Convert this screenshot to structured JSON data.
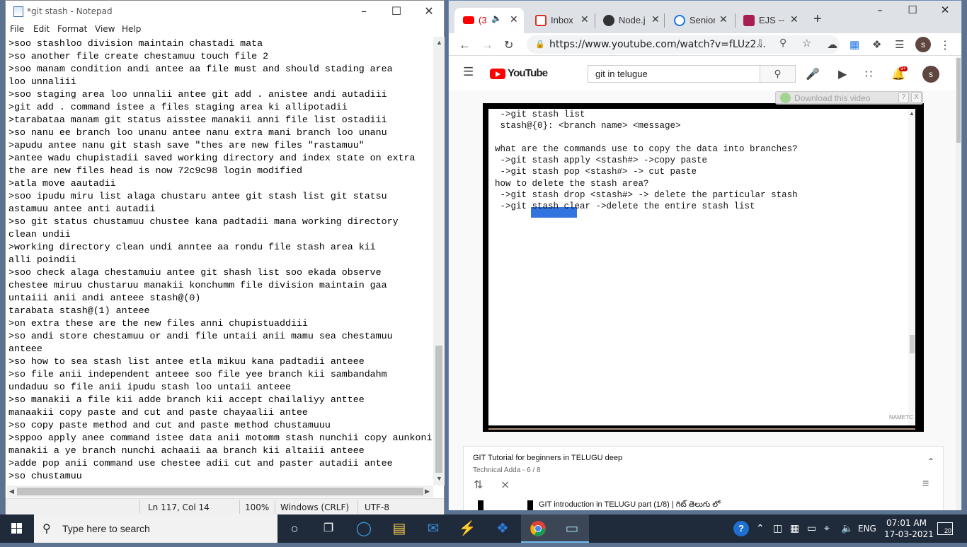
{
  "notepad": {
    "title": "*git stash - Notepad",
    "menu": [
      "File",
      "Edit",
      "Format",
      "View",
      "Help"
    ],
    "lines": [
      ">soo stashloo division maintain chastadi mata",
      ">so another file create chestamuu touch file 2",
      ">soo manam condition andi antee aa file must and should stading area",
      "loo unnaliii",
      ">soo staging area loo unnalii antee git add . anistee andi autadiii",
      ">git add . command istee a files staging area ki allipotadii",
      ">tarabataa manam git status aisstee manakii anni file list ostadiii",
      ">so nanu ee branch loo unanu antee nanu extra mani branch loo unanu",
      ">apudu antee nanu git stash save \"thes are new files \"rastamuu\"",
      ">antee wadu chupistadii saved working directory and index state on extra",
      "the are new files head is now 72c9c98 login modified",
      ">atla move aautadii",
      ">soo ipudu miru list alaga chustaru antee git stash list git statsu",
      "astamuu antee anti autadii",
      ">so git status chustamuu chustee kana padtadii mana working directory",
      "clean undii",
      ">working directory clean undi anntee aa rondu file stash area kii",
      "alli poindii",
      ">soo check alaga chestamuiu antee git shash list soo ekada observe",
      "chestee miruu chustaruu manakii konchumm file division maintain gaa",
      "untaiii anii andi anteee stash@(0)",
      "tarabata stash@(1) anteee",
      ">on extra these are the new files anni chupistuaddiii",
      ">so andi store chestamuu or andi file untaii anii mamu sea chestamuu",
      "anteee",
      ">so how to sea stash list antee etla mikuu kana padtadii anteee",
      ">so file anii independent anteee soo file yee branch kii sambandahm",
      "undaduu so file anii ipudu stash loo untaii anteee",
      ">so manakii a file kii adde branch kii accept chailaliyy anttee",
      "manaakii copy paste and cut and paste chayaalii antee",
      ">so copy paste method and cut and paste method chustamuuu",
      ">sppoo apply anee command istee data anii motomm stash nunchii copy aunkoni",
      "manakii a ye branch nunchi achaaii aa branch kii altaiii anteee",
      ">adde pop anii command use chestee adii cut and paster autadii antee",
      ">so chustamuu"
    ],
    "status": {
      "position": "Ln 117, Col 14",
      "zoom": "100%",
      "line_ending": "Windows (CRLF)",
      "encoding": "UTF-8"
    }
  },
  "chrome": {
    "tabs": [
      {
        "label": "(3",
        "icon": "youtube-icon",
        "active": true
      },
      {
        "label": "Inbox (",
        "icon": "gmail-icon"
      },
      {
        "label": "Node.j",
        "icon": "node-icon"
      },
      {
        "label": "Senior",
        "icon": "info-icon"
      },
      {
        "label": "EJS --",
        "icon": "ejs-icon"
      }
    ],
    "url": "https://www.youtube.com/watch?v=fLUz2...",
    "profile_initial": "s"
  },
  "youtube": {
    "logo_text": "YouTube",
    "search_value": "git in telugue",
    "notification_count": "9+",
    "avatar_initial": "s",
    "download_label": "Download this video",
    "download_help": "?",
    "download_close": "X",
    "video_lines": [
      " ->git stash list",
      " stash@{0}: <branch name> <message>",
      "",
      "what are the commands use to copy the data into branches?",
      " ->git stash apply <stash#> ->copy paste",
      " ->git stash pop <stash#> -> cut paste",
      "how to delete the stash area?",
      " ->git stash drop <stash#> -> delete the particular stash",
      " ->git stash clear ->delete the entire stash list"
    ],
    "watermark": "NAMETC",
    "playlist": {
      "title": "GIT Tutorial for beginners in TELUGU deep",
      "subtitle": "Technical Adda - 6 / 8",
      "next_item": "GIT introduction in TELUGU part (1/8) | గిట్ తెలుగు లో"
    }
  },
  "taskbar": {
    "search_placeholder": "Type here to search",
    "language": "ENG",
    "time": "07:01 AM",
    "date": "17-03-2021",
    "notification_count": "20"
  },
  "colors": {
    "youtube_red": "#ff0000",
    "selection_blue": "#3273e0",
    "taskbar": "#1f2a3a",
    "chrome_tabstrip": "#dee1e6"
  }
}
